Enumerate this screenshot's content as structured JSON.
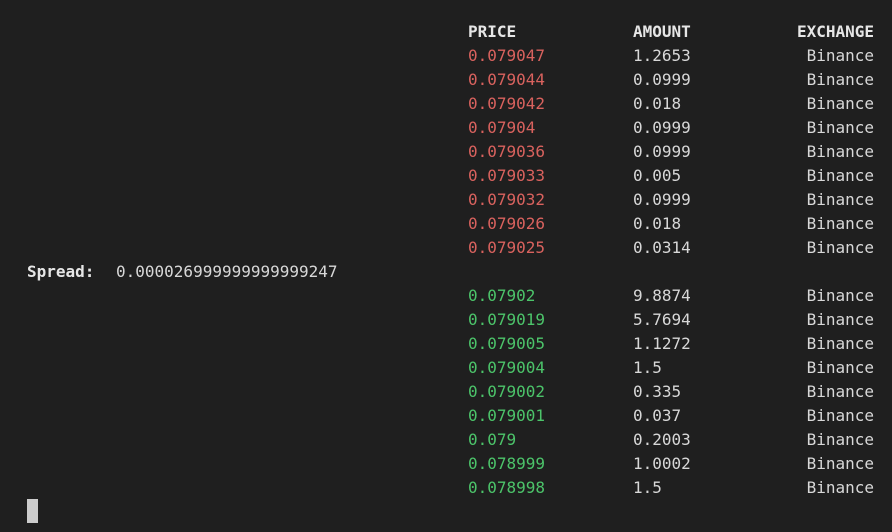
{
  "headers": {
    "price": "PRICE",
    "amount": "AMOUNT",
    "exchange": "EXCHANGE"
  },
  "asks": [
    {
      "price": "0.079047",
      "amount": "1.2653",
      "exchange": "Binance"
    },
    {
      "price": "0.079044",
      "amount": "0.0999",
      "exchange": "Binance"
    },
    {
      "price": "0.079042",
      "amount": "0.018",
      "exchange": "Binance"
    },
    {
      "price": "0.07904",
      "amount": "0.0999",
      "exchange": "Binance"
    },
    {
      "price": "0.079036",
      "amount": "0.0999",
      "exchange": "Binance"
    },
    {
      "price": "0.079033",
      "amount": "0.005",
      "exchange": "Binance"
    },
    {
      "price": "0.079032",
      "amount": "0.0999",
      "exchange": "Binance"
    },
    {
      "price": "0.079026",
      "amount": "0.018",
      "exchange": "Binance"
    },
    {
      "price": "0.079025",
      "amount": "0.0314",
      "exchange": "Binance"
    }
  ],
  "spread": {
    "label": "Spread:",
    "value": "0.000026999999999999247"
  },
  "bids": [
    {
      "price": "0.07902",
      "amount": "9.8874",
      "exchange": "Binance"
    },
    {
      "price": "0.079019",
      "amount": "5.7694",
      "exchange": "Binance"
    },
    {
      "price": "0.079005",
      "amount": "1.1272",
      "exchange": "Binance"
    },
    {
      "price": "0.079004",
      "amount": "1.5",
      "exchange": "Binance"
    },
    {
      "price": "0.079002",
      "amount": "0.335",
      "exchange": "Binance"
    },
    {
      "price": "0.079001",
      "amount": "0.037",
      "exchange": "Binance"
    },
    {
      "price": "0.079",
      "amount": "0.2003",
      "exchange": "Binance"
    },
    {
      "price": "0.078999",
      "amount": "1.0002",
      "exchange": "Binance"
    },
    {
      "price": "0.078998",
      "amount": "1.5",
      "exchange": "Binance"
    }
  ],
  "colors": {
    "background": "#1f1f1f",
    "ask_price": "#d9625e",
    "bid_price": "#4cc46a",
    "text": "#d8d8d8"
  }
}
